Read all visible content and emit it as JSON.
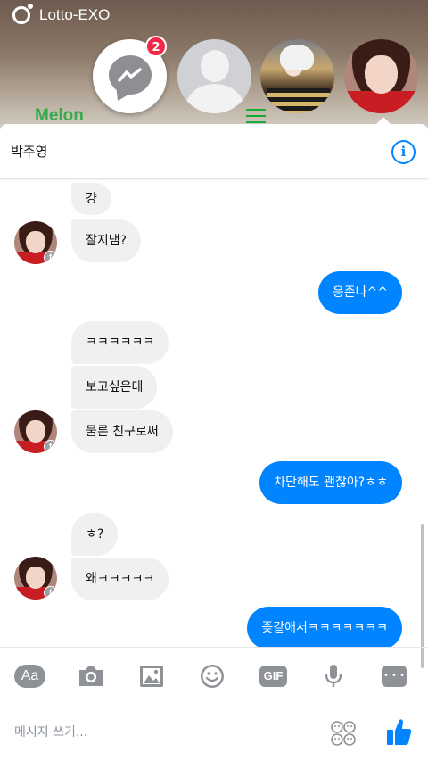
{
  "status_bar": {
    "app_name": "Lotto-EXO"
  },
  "background_app": {
    "logo_text": "Melon"
  },
  "chat_heads": {
    "messenger_badge_count": "2"
  },
  "header": {
    "contact_name": "박주영",
    "info_icon": "i"
  },
  "messages": [
    {
      "direction": "in",
      "text": "걍"
    },
    {
      "direction": "in",
      "text": "잘지냄?"
    },
    {
      "direction": "out",
      "text": "응존나^^"
    },
    {
      "direction": "in",
      "text": "ㅋㅋㅋㅋㅋㅋ"
    },
    {
      "direction": "in",
      "text": "보고싶은데"
    },
    {
      "direction": "in",
      "text": "물론 친구로써"
    },
    {
      "direction": "out",
      "text": "차단해도 괜찮아?ㅎㅎ"
    },
    {
      "direction": "in",
      "text": "ㅎ?"
    },
    {
      "direction": "in",
      "text": "왜ㅋㅋㅋㅋㅋ"
    },
    {
      "direction": "out",
      "text": "좆같애서ㅋㅋㅋㅋㅋㅋㅋ"
    }
  ],
  "avatar_badge": "f",
  "toolbar": {
    "text_style_label": "Aa",
    "gif_label": "GIF",
    "icons": [
      "text-style-icon",
      "camera-icon",
      "image-icon",
      "emoji-icon",
      "gif-icon",
      "microphone-icon",
      "more-icon"
    ]
  },
  "composer": {
    "placeholder": "메시지 쓰기..."
  },
  "colors": {
    "accent": "#0084ff",
    "incoming_bubble": "#f1f0f0",
    "badge": "#f02849",
    "icon_gray": "#8e9196"
  }
}
